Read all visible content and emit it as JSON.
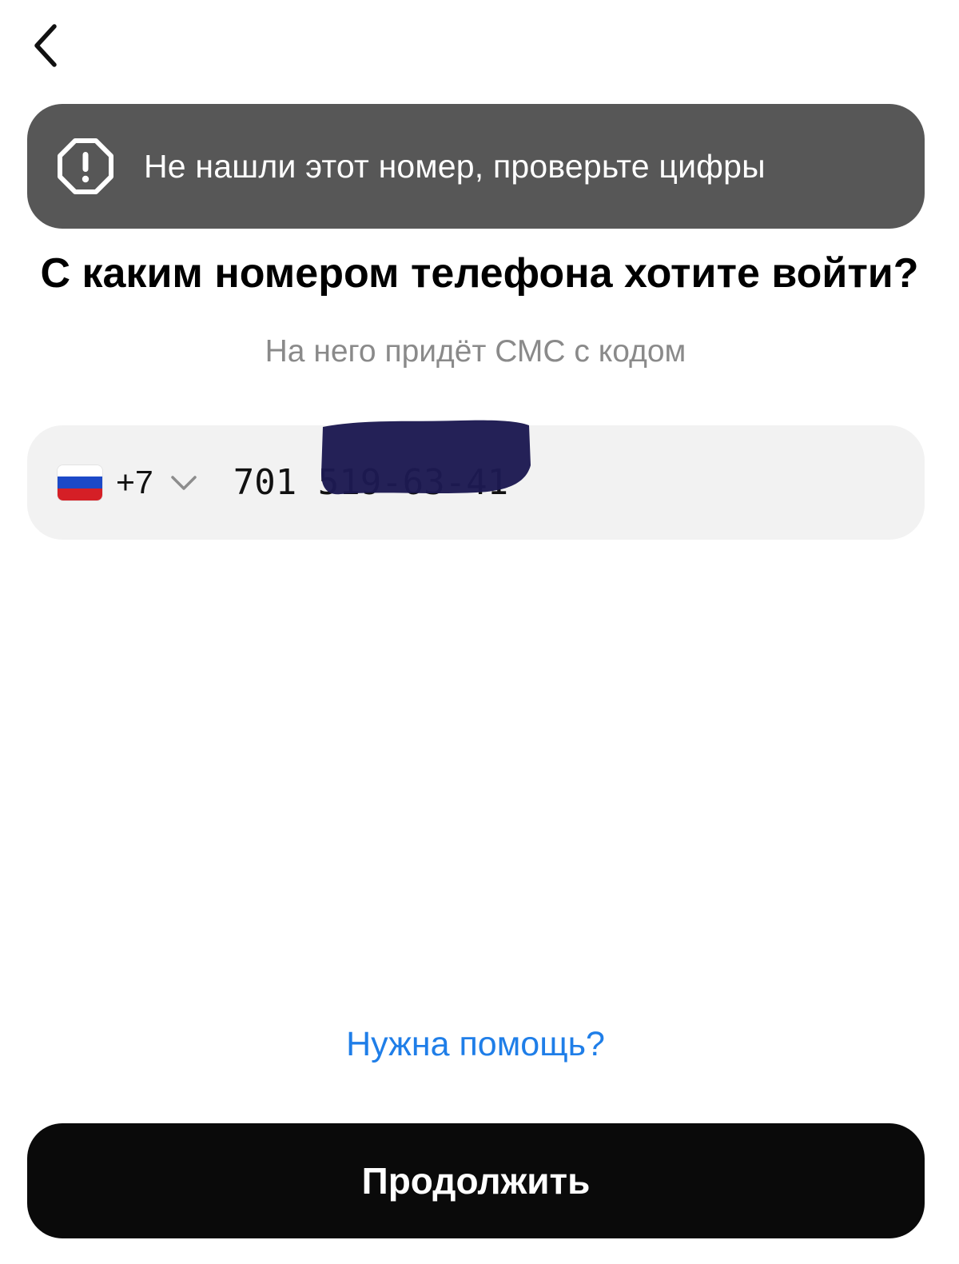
{
  "nav": {
    "back_icon": "chevron-left-icon"
  },
  "toast": {
    "icon": "alert-octagon-icon",
    "message": "Не нашли этот номер, проверьте цифры",
    "background_color": "#575757"
  },
  "title": "С каким номером телефона хотите войти?",
  "subtitle": "На него придёт СМС с кодом",
  "phone": {
    "country_flag": "russia-flag-icon",
    "country_code": "+7",
    "dropdown_icon": "chevron-down-icon",
    "value": "701 519-63-41"
  },
  "help_link": "Нужна помощь?",
  "continue_button": "Продолжить",
  "colors": {
    "link": "#1f7ee8",
    "button": "#0a0a0a",
    "field_background": "#f2f2f2",
    "subtitle": "#8a8a8a"
  }
}
